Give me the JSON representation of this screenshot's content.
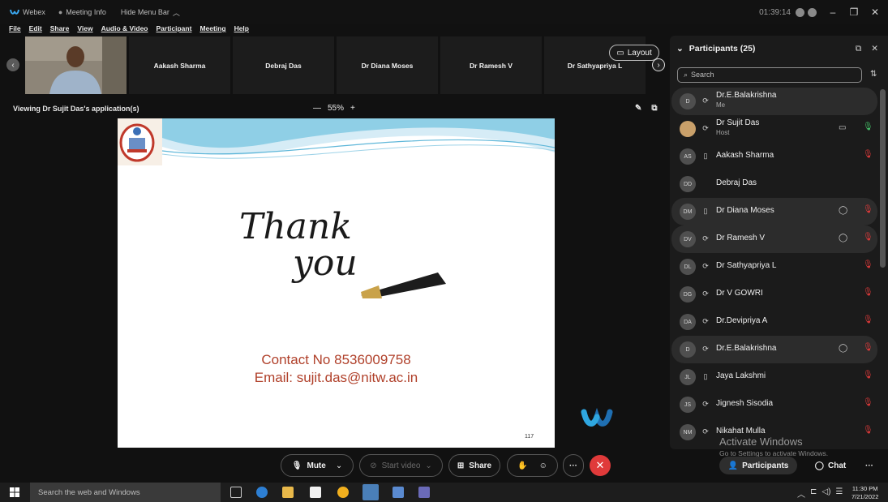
{
  "titlebar": {
    "app_name": "Webex",
    "meeting_info": "Meeting Info",
    "hide_menu_bar": "Hide Menu Bar",
    "timer": "01:39:14"
  },
  "menu": [
    "File",
    "Edit",
    "Share",
    "View",
    "Audio & Video",
    "Participant",
    "Meeting",
    "Help"
  ],
  "strip": {
    "tiles": [
      "Aakash Sharma",
      "Debraj Das",
      "Dr Diana Moses",
      "Dr Ramesh V",
      "Dr Sathyapriya L"
    ],
    "layout_label": "Layout"
  },
  "share": {
    "viewing": "Viewing Dr Sujit Das's application(s)",
    "zoom": "55%"
  },
  "slide": {
    "contact_line": "Contact No 8536009758",
    "email_line": "Email: sujit.das@nitw.ac.in",
    "page_number": "117",
    "thank": "Thank",
    "you": "you"
  },
  "panel": {
    "title": "Participants (25)",
    "search_placeholder": "Search",
    "participants": [
      {
        "initials": "D",
        "name": "Dr.E.Balakrishna",
        "sub": "Me",
        "device": "headset",
        "highlight": true,
        "chat": false,
        "mic": "none"
      },
      {
        "initials": "",
        "name": "Dr Sujit Das",
        "sub": "Host",
        "device": "headset",
        "highlight": false,
        "chat": false,
        "mic": "on",
        "video": true
      },
      {
        "initials": "AS",
        "name": "Aakash Sharma",
        "sub": "",
        "device": "phone",
        "highlight": false,
        "chat": false,
        "mic": "muted"
      },
      {
        "initials": "DD",
        "name": "Debraj Das",
        "sub": "",
        "device": "",
        "highlight": false,
        "chat": false,
        "mic": "none"
      },
      {
        "initials": "DM",
        "name": "Dr Diana Moses",
        "sub": "",
        "device": "phone",
        "highlight": true,
        "chat": true,
        "mic": "muted"
      },
      {
        "initials": "DV",
        "name": "Dr Ramesh V",
        "sub": "",
        "device": "headset",
        "highlight": true,
        "chat": true,
        "mic": "muted"
      },
      {
        "initials": "DL",
        "name": "Dr Sathyapriya L",
        "sub": "",
        "device": "headset",
        "highlight": false,
        "chat": false,
        "mic": "muted"
      },
      {
        "initials": "DG",
        "name": "Dr V GOWRI",
        "sub": "",
        "device": "headset",
        "highlight": false,
        "chat": false,
        "mic": "muted"
      },
      {
        "initials": "DA",
        "name": "Dr.Devipriya A",
        "sub": "",
        "device": "headset",
        "highlight": false,
        "chat": false,
        "mic": "muted"
      },
      {
        "initials": "D",
        "name": "Dr.E.Balakrishna",
        "sub": "",
        "device": "headset",
        "highlight": true,
        "chat": true,
        "mic": "muted"
      },
      {
        "initials": "JL",
        "name": "Jaya Lakshmi",
        "sub": "",
        "device": "phone",
        "highlight": false,
        "chat": false,
        "mic": "muted"
      },
      {
        "initials": "JS",
        "name": "Jignesh Sisodia",
        "sub": "",
        "device": "headset",
        "highlight": false,
        "chat": false,
        "mic": "muted"
      },
      {
        "initials": "NM",
        "name": "Nikahat Mulla",
        "sub": "",
        "device": "headset",
        "highlight": false,
        "chat": false,
        "mic": "muted"
      }
    ]
  },
  "watermark": {
    "line1": "Activate Windows",
    "line2": "Go to Settings to activate Windows."
  },
  "controls": {
    "mute": "Mute",
    "start_video": "Start video",
    "share": "Share",
    "participants": "Participants",
    "chat": "Chat",
    "more": "···"
  },
  "taskbar": {
    "search_placeholder": "Search the web and Windows",
    "time": "11:30 PM",
    "date": "7/21/2022"
  },
  "colors": {
    "end_call": "#e03a3a",
    "mic_muted": "#e03a3a",
    "mic_on": "#46c46a",
    "contact_text": "#b0402a"
  }
}
